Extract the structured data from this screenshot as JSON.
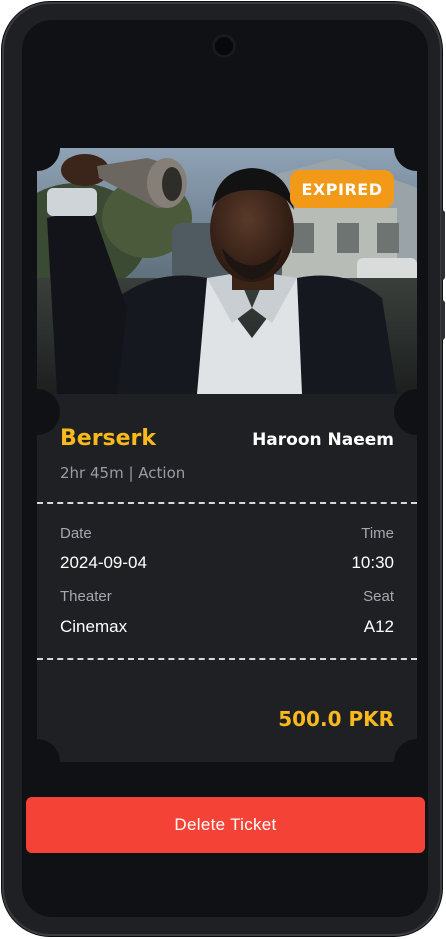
{
  "ticket": {
    "status": "EXPIRED",
    "movie_title": "Berserk",
    "customer_name": "Haroon Naeem",
    "duration_genre": "2hr 45m | Action",
    "date_label": "Date",
    "date_value": "2024-09-04",
    "time_label": "Time",
    "time_value": "10:30",
    "theater_label": "Theater",
    "theater_value": "Cinemax",
    "seat_label": "Seat",
    "seat_value": "A12",
    "price": "500.0 PKR"
  },
  "actions": {
    "delete_label": "Delete Ticket"
  },
  "colors": {
    "accent": "#f7b91c",
    "expired_badge": "#f29a17",
    "delete_button": "#f44336",
    "card_bg": "#1f2024",
    "screen_bg": "#101114"
  }
}
